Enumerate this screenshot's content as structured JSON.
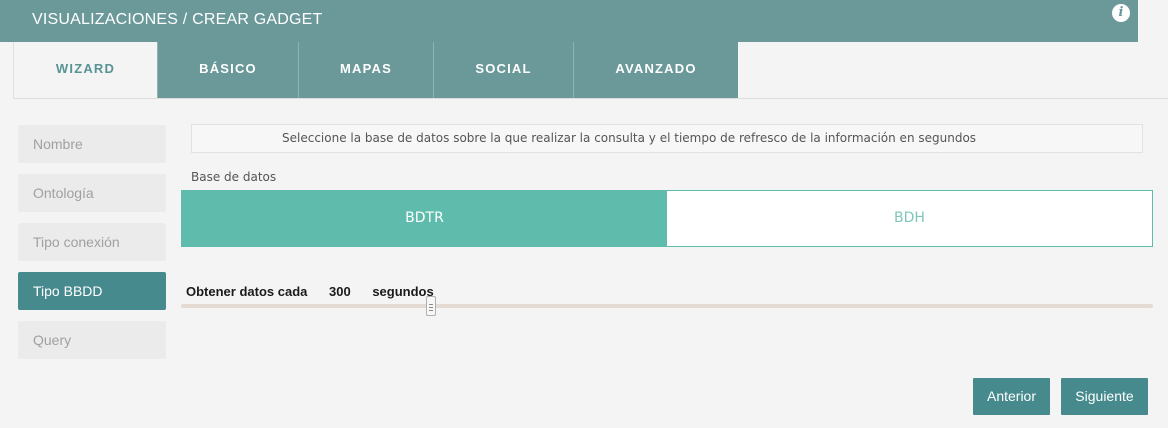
{
  "header": {
    "title": "VISUALIZACIONES / CREAR GADGET",
    "info_icon": "info-icon"
  },
  "tabs": [
    {
      "label": "WIZARD",
      "active": true
    },
    {
      "label": "BÁSICO",
      "active": false
    },
    {
      "label": "MAPAS",
      "active": false
    },
    {
      "label": "SOCIAL",
      "active": false
    },
    {
      "label": "AVANZADO",
      "active": false
    }
  ],
  "sidebar": {
    "items": [
      {
        "label": "Nombre",
        "active": false
      },
      {
        "label": "Ontología",
        "active": false
      },
      {
        "label": "Tipo conexión",
        "active": false
      },
      {
        "label": "Tipo BBDD",
        "active": true
      },
      {
        "label": "Query",
        "active": false
      }
    ]
  },
  "main": {
    "instruction": "Seleccione la base de datos sobre la que realizar la consulta y el tiempo de refresco de la información en segundos",
    "db_label": "Base de datos",
    "db_options": [
      {
        "label": "BDTR",
        "selected": true
      },
      {
        "label": "BDH",
        "selected": false
      }
    ],
    "refresh": {
      "prefix": "Obtener datos cada",
      "value": "300",
      "suffix": "segundos",
      "slider_fraction": 0.257
    }
  },
  "footer": {
    "prev_label": "Anterior",
    "next_label": "Siguiente"
  },
  "colors": {
    "header_bg": "#6b9999",
    "accent_teal": "#468a8e",
    "toggle_selected": "#5fbcad"
  }
}
